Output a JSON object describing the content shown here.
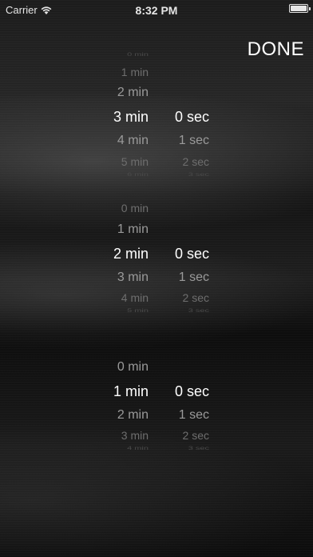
{
  "status_bar": {
    "carrier": "Carrier",
    "time": "8:32 PM"
  },
  "done_label": "DONE",
  "pickers": [
    {
      "minutes": [
        "0 min",
        "1 min",
        "2 min",
        "3 min",
        "4 min",
        "5 min",
        "6 min"
      ],
      "seconds": [
        "0 sec",
        "1 sec",
        "2 sec",
        "3 sec"
      ]
    },
    {
      "minutes": [
        "0 min",
        "1 min",
        "2 min",
        "3 min",
        "4 min",
        "5 min"
      ],
      "seconds": [
        "0 sec",
        "1 sec",
        "2 sec",
        "3 sec"
      ]
    },
    {
      "minutes": [
        "0 min",
        "1 min",
        "2 min",
        "3 min",
        "4 min"
      ],
      "seconds": [
        "0 sec",
        "1 sec",
        "2 sec",
        "3 sec"
      ]
    }
  ],
  "colors": {
    "selected_text": "#ffffff",
    "faded_text": "#9a9a9a",
    "background": "#141414"
  }
}
